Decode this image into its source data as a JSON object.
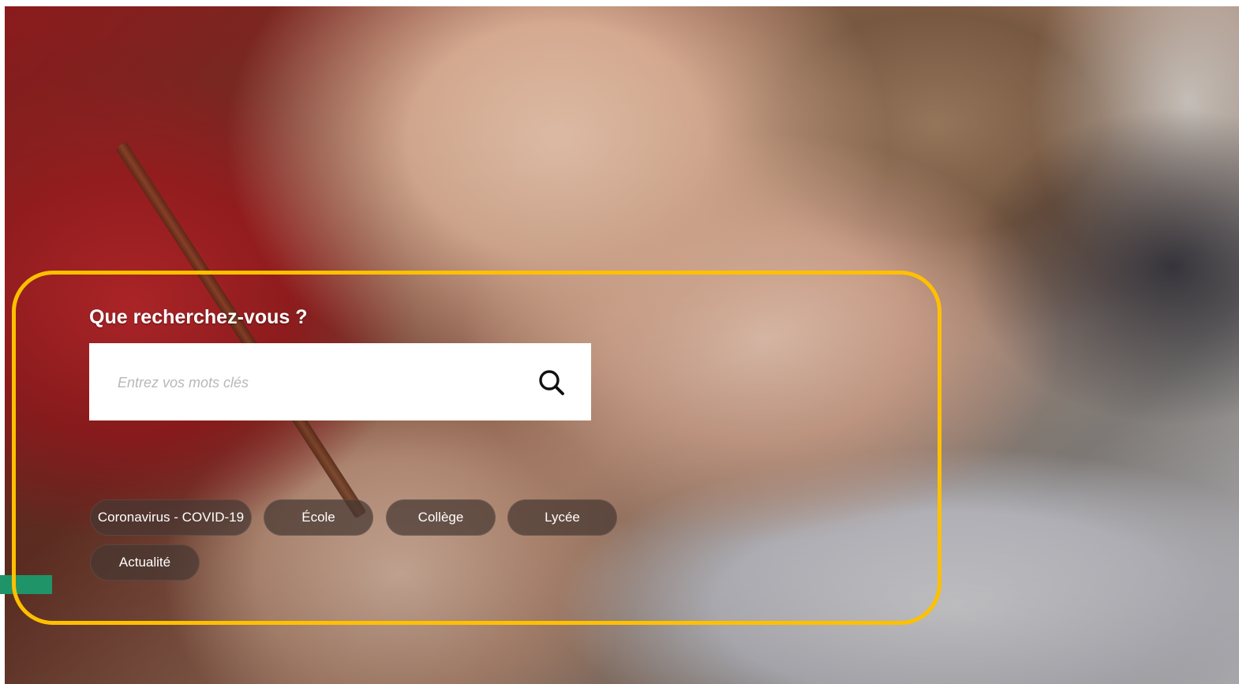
{
  "search": {
    "title": "Que recherchez-vous ?",
    "placeholder": "Entrez vos mots clés",
    "button_icon": "search-icon"
  },
  "tags": [
    {
      "label": "Coronavirus - COVID-19"
    },
    {
      "label": "École"
    },
    {
      "label": "Collège"
    },
    {
      "label": "Lycée"
    },
    {
      "label": "Actualité"
    }
  ],
  "colors": {
    "highlight_frame": "#ffc000",
    "green_tab": "#1f9468",
    "tag_background": "rgba(70,55,50,0.72)"
  }
}
